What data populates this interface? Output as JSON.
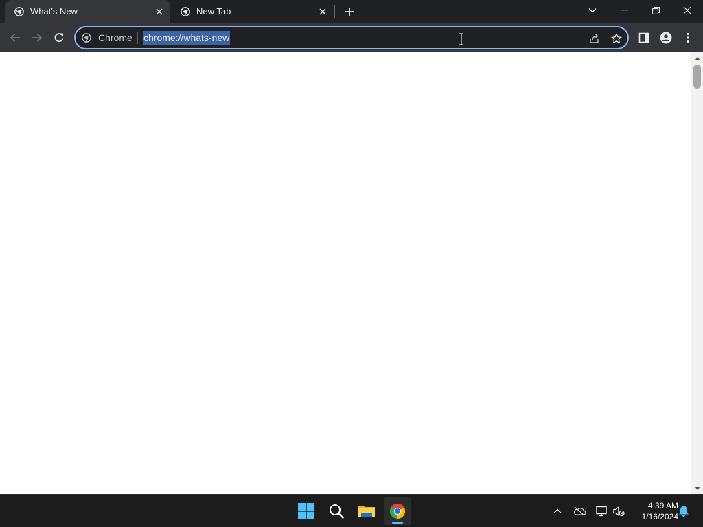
{
  "browser": {
    "tabs": [
      {
        "title": "What's New",
        "active": true
      },
      {
        "title": "New Tab",
        "active": false
      }
    ],
    "omnibox": {
      "chip_label": "Chrome",
      "url": "chrome://whats-new",
      "url_selected": true
    },
    "icons": {
      "tab_favicon": "chrome-icon",
      "tab_close": "close-icon",
      "new_tab": "plus-icon",
      "tab_search": "chevron-down-icon",
      "minimize": "minimize-icon",
      "restore": "restore-icon",
      "close_window": "close-icon",
      "back": "arrow-left-icon",
      "forward": "arrow-right-icon",
      "reload": "reload-icon",
      "share": "share-icon",
      "bookmark": "star-icon",
      "side_panel": "side-panel-icon",
      "profile": "person-icon",
      "menu": "kebab-menu-icon"
    }
  },
  "taskbar": {
    "apps": [
      "windows-start-icon",
      "search-icon",
      "file-explorer-icon",
      "chrome-icon"
    ],
    "active_app": "chrome-icon",
    "tray": [
      "chevron-up-icon",
      "onedrive-icon",
      "network-icon",
      "volume-muted-icon",
      "notification-bell-icon"
    ],
    "clock": {
      "time": "4:39 AM",
      "date": "1/16/2024"
    }
  },
  "colors": {
    "tabstrip_bg": "#202124",
    "toolbar_bg": "#35363a",
    "omnibox_focus": "#8ab4f8",
    "selection": "#3c63a3",
    "taskbar_bg": "#1c1c1c",
    "running_indicator": "#4cc2ff",
    "notification_bell": "#4cc2ff"
  }
}
